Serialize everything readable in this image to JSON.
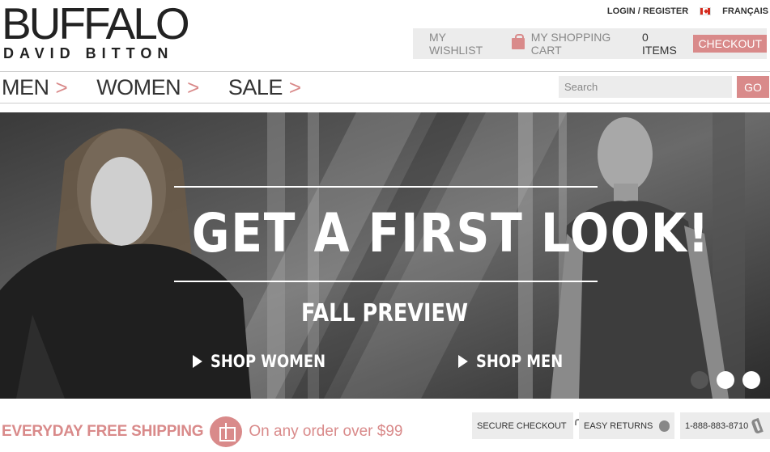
{
  "brand": {
    "name": "BUFFALO",
    "sub": "DAVID BITTON"
  },
  "top_links": {
    "login": "LOGIN / REGISTER",
    "language": "FRANÇAIS",
    "flag_icon": "canada-flag-icon"
  },
  "cart_bar": {
    "wishlist": "MY WISHLIST",
    "cart_label": "MY SHOPPING CART",
    "items": "0 ITEMS",
    "checkout": "CHECKOUT",
    "bag_icon": "shopping-bag-icon"
  },
  "nav": {
    "items": [
      {
        "label": "MEN",
        "chevron": ">"
      },
      {
        "label": "WOMEN",
        "chevron": ">"
      },
      {
        "label": "SALE",
        "chevron": ">"
      }
    ]
  },
  "search": {
    "placeholder": "Search",
    "button": "GO"
  },
  "hero": {
    "title": "GET A FIRST LOOK!",
    "subtitle": "FALL PREVIEW",
    "cta_women": "SHOP WOMEN",
    "cta_men": "SHOP MEN",
    "slides": 3,
    "active_slide": 1
  },
  "footer": {
    "ship_strong": "EVERYDAY FREE SHIPPING",
    "ship_soft": "On any order over $99",
    "secure": "SECURE CHECKOUT",
    "returns": "EASY RETURNS",
    "phone": "1-888-883-8710"
  },
  "colors": {
    "accent": "#d98a8a",
    "panel": "#ececec",
    "text": "#333333"
  }
}
